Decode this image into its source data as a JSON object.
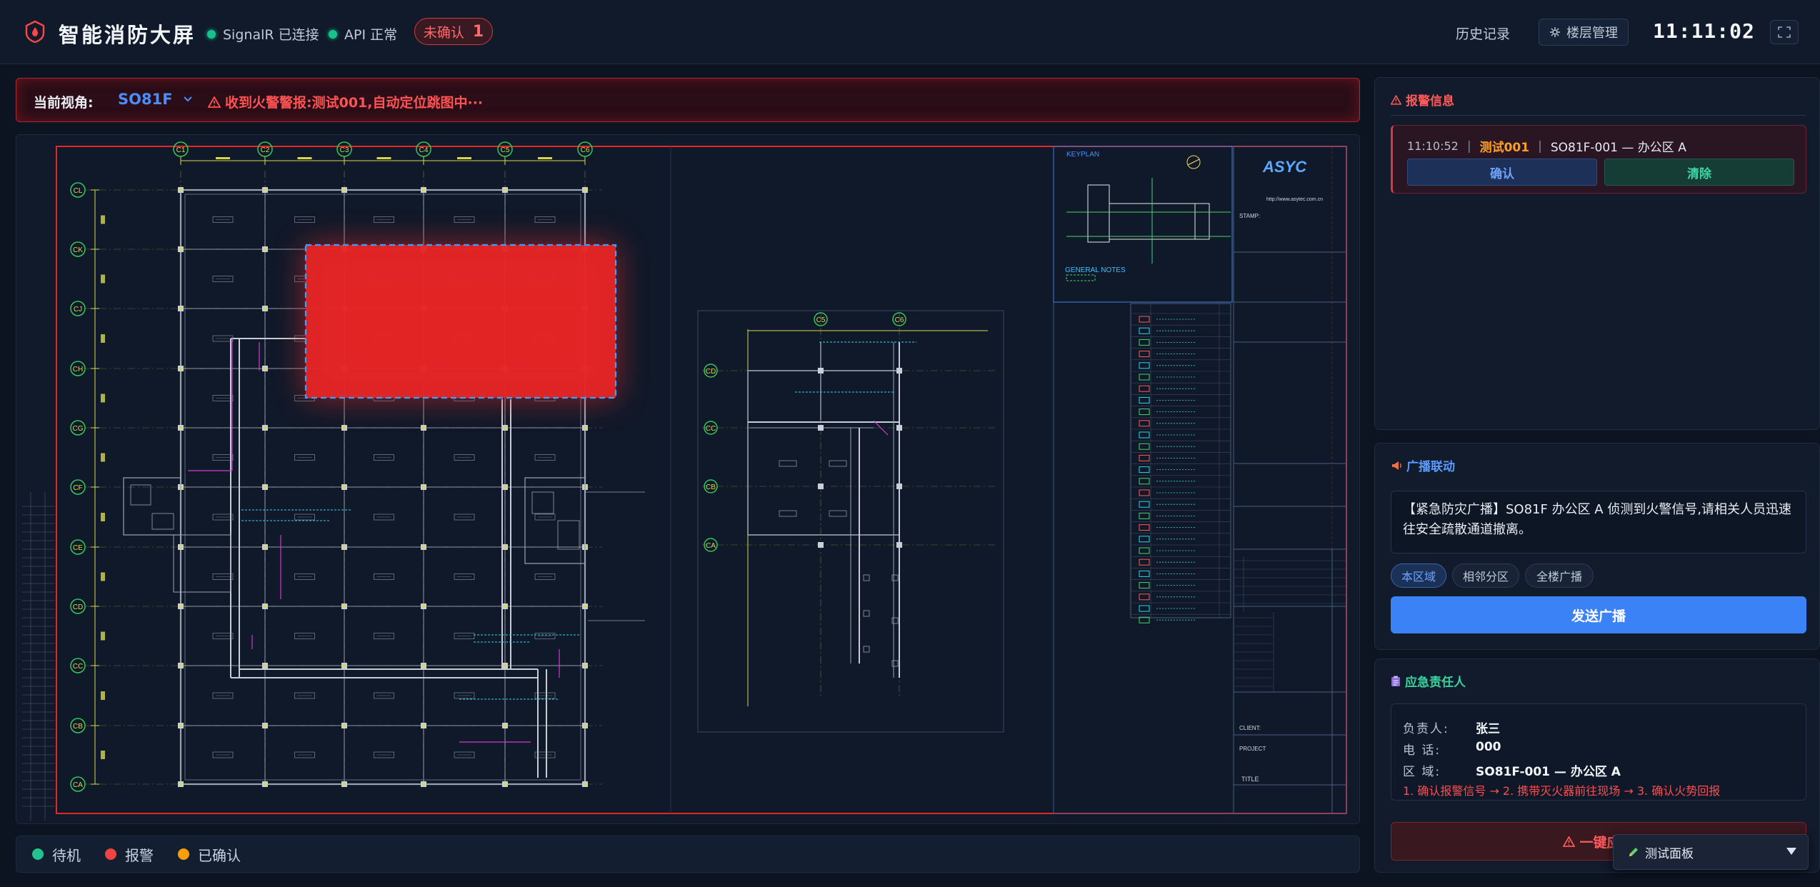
{
  "header": {
    "title": "智能消防大屏",
    "signalr_status": "SignalR 已连接",
    "api_status": "API 正常",
    "unack_label": "未确认",
    "unack_count": "1",
    "history_label": "历史记录",
    "floor_mgmt_label": "楼层管理",
    "clock": "11:11:02"
  },
  "view_bar": {
    "label": "当前视角:",
    "floor": "SO81F",
    "alert_text": "收到火警警报:测试001,自动定位跳图中···"
  },
  "legend": {
    "items": [
      {
        "label": "待机",
        "color": "#22c38e"
      },
      {
        "label": "报警",
        "color": "#ef4444"
      },
      {
        "label": "已确认",
        "color": "#f59e0b"
      }
    ]
  },
  "alarm_panel": {
    "title": "报警信息",
    "alarm": {
      "time": "11:10:52",
      "name": "测试001",
      "location": "SO81F-001 — 办公区 A"
    },
    "confirm_label": "确认",
    "clear_label": "清除"
  },
  "broadcast_panel": {
    "title": "广播联动",
    "message": "【紧急防灾广播】SO81F 办公区 A 侦测到火警信号,请相关人员迅速往安全疏散通道撤离。",
    "scopes": [
      "本区域",
      "相邻分区",
      "全楼广播"
    ],
    "send_label": "发送广播"
  },
  "emergency_panel": {
    "title": "应急责任人",
    "rows": [
      {
        "k": "负责人:",
        "v": "张三"
      },
      {
        "k": "电 话:",
        "v": "000"
      },
      {
        "k": "区 域:",
        "v": "SO81F-001 — 办公区 A"
      }
    ],
    "steps": "1. 确认报警信号 → 2. 携带灭火器前往现场 → 3. 确认火势回报",
    "emergency_label": "一键应急"
  },
  "test_panel": {
    "label": "测试面板"
  },
  "map": {
    "keyplan_label": "KEYPLAN",
    "general_notes_label": "GENERAL NOTES",
    "company_logo": "ASYC",
    "company_url": "http://www.asytec.com.cn",
    "stamp_label": "STAMP:",
    "project_label": "PROJECT",
    "title_label": "TITLE",
    "client_label": "CLIENT:",
    "grid_top": [
      "C1",
      "C2",
      "C3",
      "C4",
      "C5",
      "C6"
    ],
    "grid_left": [
      "CL",
      "CK",
      "CJ",
      "CH",
      "CG",
      "CF",
      "CE",
      "CD",
      "CC",
      "CB",
      "CA"
    ],
    "grid_top_right": [
      "C5",
      "C6"
    ],
    "grid_left_right": [
      "CD",
      "CC",
      "CB",
      "CA"
    ],
    "colors": {
      "alarm": "#e62525",
      "cad_line": "#9aa3b0",
      "grid": "#d8d84a",
      "bubble": "#34c759"
    }
  }
}
